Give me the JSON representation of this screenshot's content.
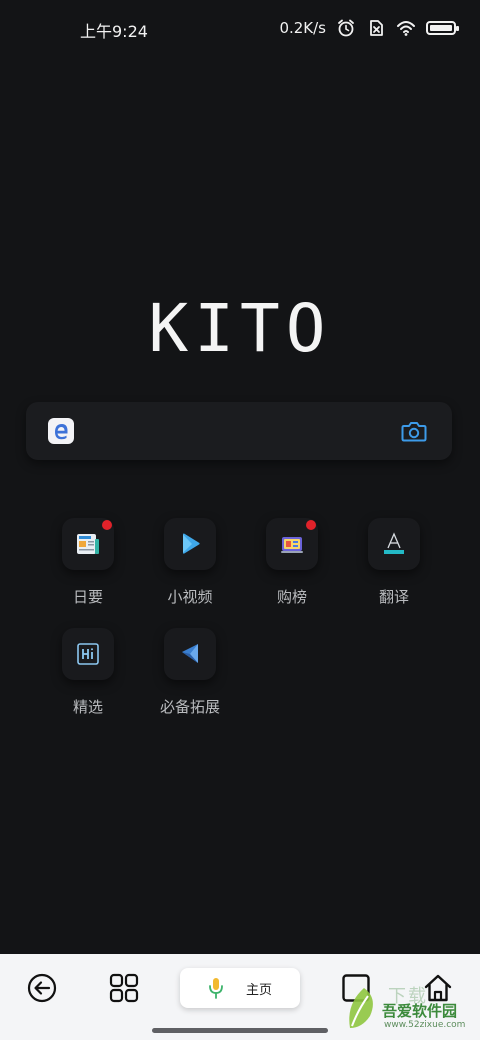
{
  "status_bar": {
    "time": "上午9:24",
    "net_speed": "0.2K/s",
    "icons": [
      "alarm-icon",
      "sim-disabled-icon",
      "wifi-icon",
      "battery-icon"
    ],
    "battery_level": 1.0
  },
  "logo": "KITO",
  "search": {
    "engine_icon": "edge-browser-icon",
    "camera_icon": "camera-icon"
  },
  "tiles": [
    {
      "label": "日要",
      "icon": "news-icon",
      "badge": true
    },
    {
      "label": "小视频",
      "icon": "play-icon",
      "badge": false
    },
    {
      "label": "购榜",
      "icon": "shopping-icon",
      "badge": true
    },
    {
      "label": "翻译",
      "icon": "translate-icon",
      "badge": false
    },
    {
      "label": "精选",
      "icon": "featured-icon",
      "badge": false
    },
    {
      "label": "必备拓展",
      "icon": "extension-icon",
      "badge": false
    }
  ],
  "bottom_bar": {
    "home_label": "主页",
    "buttons": [
      "back-icon",
      "grid-menu-icon",
      "microphone-icon",
      "tabs-icon",
      "home-icon"
    ]
  },
  "watermark": {
    "title": "吾爱软件园",
    "url": "www.52zixue.com",
    "overlay": "下载"
  },
  "colors": {
    "background": "#131416",
    "bottom_bar": "#f4f5f7",
    "badge": "#e0222a",
    "accent_blue": "#3d9be9"
  }
}
